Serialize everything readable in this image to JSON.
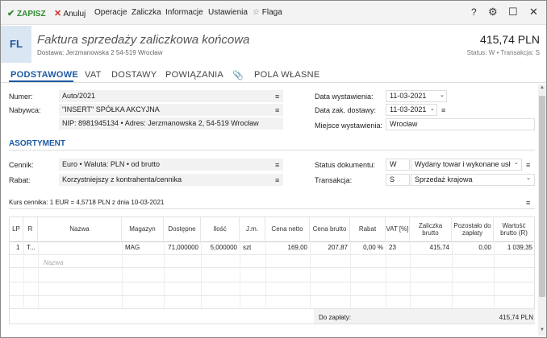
{
  "toolbar": {
    "save_label": "ZAPISZ",
    "cancel_label": "Anuluj",
    "operations_label": "Operacje",
    "advance_label": "Zaliczka",
    "info_label": "Informacje",
    "settings_label": "Ustawienia",
    "flag_label": "Flaga",
    "help_glyph": "?",
    "gear_glyph": "⚙",
    "max_glyph": "☐",
    "close_glyph": "✕"
  },
  "header": {
    "badge": "FL",
    "title": "Faktura sprzedaży zaliczkowa końcowa",
    "subtitle": "Dostawa: Jerzmanowska 2 54-519 Wrocław",
    "amount": "415,74 PLN",
    "status": "Status: W  •  Transakcja: S"
  },
  "tabs": [
    "PODSTAWOWE",
    "VAT",
    "DOSTAWY",
    "POWIĄZANIA",
    "POLA WŁASNE"
  ],
  "form": {
    "numer_label": "Numer:",
    "numer_value": "Auto/2021",
    "nabywca_label": "Nabywca:",
    "nabywca_value": "\"INSERT\" SPÓŁKA AKCYJNA",
    "nip_value": "NIP:  8981945134  •  Adres:  Jerzmanowska 2, 54-519 Wrocław",
    "data_wyst_label": "Data wystawienia:",
    "data_wyst_value": "11-03-2021",
    "data_dost_label": "Data zak. dostawy:",
    "data_dost_value": "11-03-2021",
    "miejsce_label": "Miejsce wystawienia:",
    "miejsce_value": "Wrocław"
  },
  "asortyment": {
    "section_title": "ASORTYMENT",
    "cennik_label": "Cennik:",
    "cennik_value": "Euro • Waluta: PLN • od brutto",
    "rabat_label": "Rabat:",
    "rabat_value": "Korzystniejszy z kontrahenta/cennika",
    "status_label": "Status dokumentu:",
    "status_code": "W",
    "status_value": "Wydany towar i wykonane usł",
    "transakcja_label": "Transakcja:",
    "transakcja_code": "S",
    "transakcja_value": "Sprzedaż krajowa",
    "kurs": "Kurs cennika: 1 EUR = 4,5718 PLN z dnia 10-03-2021"
  },
  "table": {
    "headers": [
      "LP",
      "R",
      "Nazwa",
      "Magazyn",
      "Dostępne",
      "Ilość",
      "J.m.",
      "Cena netto",
      "Cena brutto",
      "Rabat",
      "VAT [%]",
      "Zaliczka brutto",
      "Pozostało do zapłaty",
      "Wartość brutto (R)"
    ],
    "row": {
      "lp": "1",
      "r": "T...",
      "nazwa": "",
      "magazyn": "MAG",
      "dostepne": "71,000000",
      "ilosc": "5,000000",
      "jm": "szt",
      "cena_netto": "169,00",
      "cena_brutto": "207,87",
      "rabat": "0,00 %",
      "vat": "23",
      "zaliczka": "415,74",
      "pozostalo": "0,00",
      "wartosc": "1 039,35"
    },
    "placeholder": "Nazwa"
  },
  "footer": {
    "label": "Do zapłaty:",
    "value": "415,74 PLN"
  },
  "colors": {
    "accent": "#1d5aa3",
    "save_green": "#2e8b2e",
    "cancel_red": "#d02b2b"
  }
}
